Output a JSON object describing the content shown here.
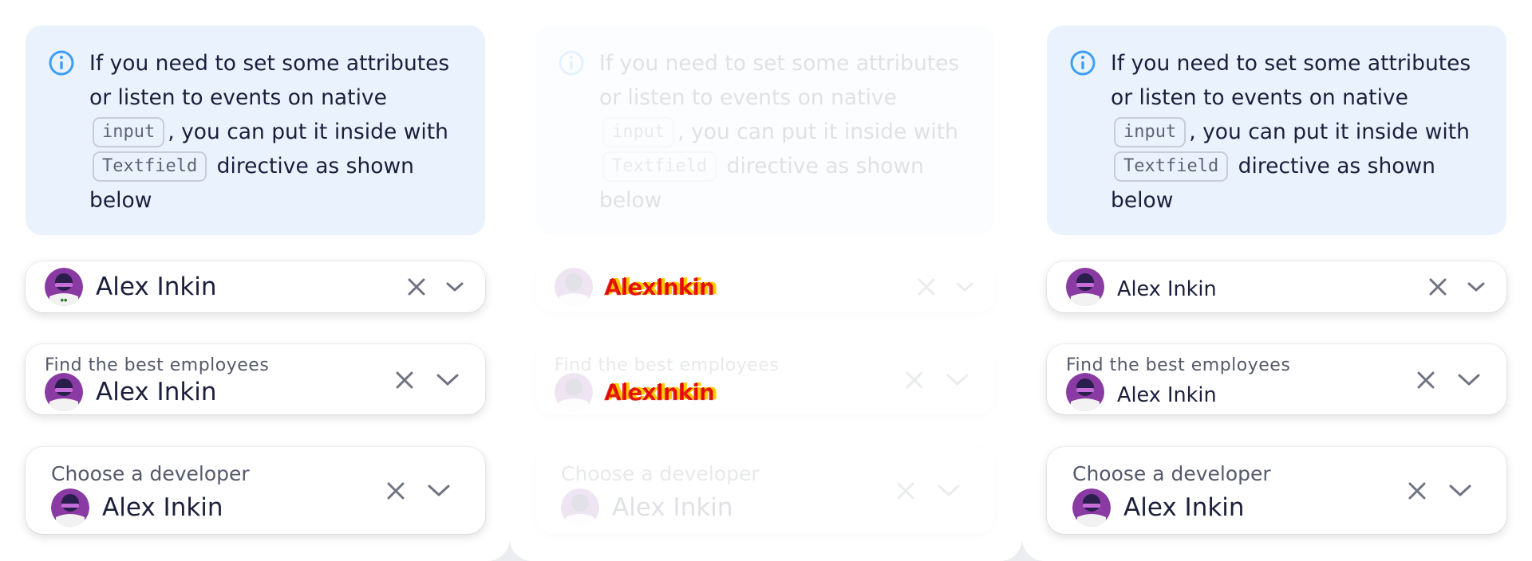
{
  "notification": {
    "text_1": "If you need to set some attributes or listen to events on native",
    "code_1": "input",
    "text_2": ", you can put it inside with",
    "code_2": "Textfield",
    "text_3": "directive as shown below"
  },
  "field_plain": {
    "value": "Alex Inkin"
  },
  "field_labeled": {
    "label": "Find the best employees",
    "value": "Alex Inkin"
  },
  "field_developer": {
    "label": "Choose a developer",
    "value": "Alex Inkin"
  },
  "glitch_value": "AlexInkin",
  "icons": {
    "info": "info-icon",
    "clear": "close-icon",
    "expand": "chevron-down-icon"
  },
  "colors": {
    "notification_bg": "#eaf3fd",
    "info_icon": "#3e9ef5",
    "text": "#1b1f3b",
    "icon_gray": "#6f7382"
  }
}
